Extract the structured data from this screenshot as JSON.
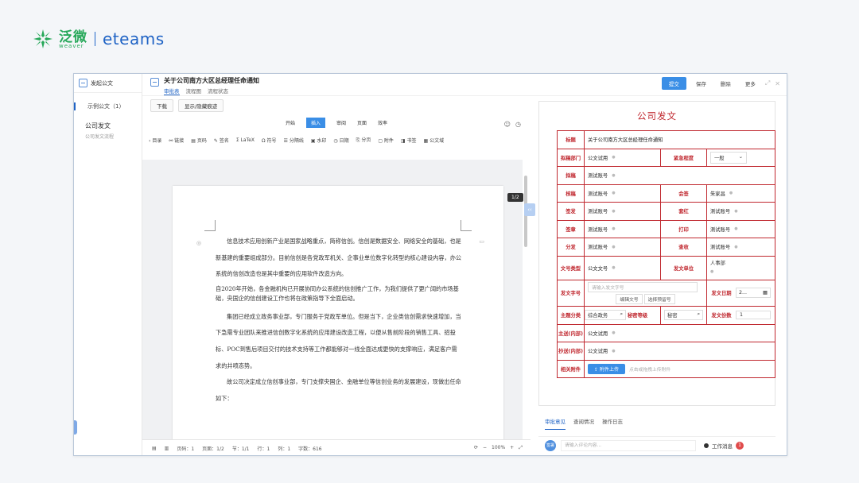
{
  "brand": {
    "cn": "泛微",
    "en": "weaver",
    "product": "eteams"
  },
  "sidebar": {
    "header": "发起公文",
    "tree_top": "示例公文（1）",
    "item": "公司发文",
    "item_sub": "公司发文流程"
  },
  "topbar": {
    "title": "关于公司南方大区总经理任命通知",
    "tabs": [
      "审批表",
      "流程图",
      "流程状态"
    ],
    "actions": {
      "submit": "提交",
      "save": "保存",
      "delete": "删除",
      "more": "更多"
    }
  },
  "editor": {
    "download": "下载",
    "toggle_marks": "显示/隐藏痕迹",
    "menu_tabs": [
      "开始",
      "插入",
      "审阅",
      "页面",
      "效率"
    ],
    "toolbar": [
      "目录",
      "链接",
      "页码",
      "签名",
      "LaTeX",
      "符号",
      "分隔线",
      "水印",
      "日期",
      "分页",
      "附件",
      "书签",
      "公文域"
    ],
    "page_badge": "1/2",
    "paragraphs": [
      "信息技术应用创新产业是国家战略重点，简称信创。信创是数据安全、网络安全的基础，也是新基建的重要组成部分。目前信创是各党政军机关、企事业单位数字化转型的核心建设内容，办公系统的信创改造也是其中重要的应用软件改造方向。",
      "自2020年开始，各金融机构已开展协同办公系统的信创推广工作，为我们提供了更广阔的市场基础，央国企的信创建设工作也将在政策指导下全面启动。",
      "集团已经成立政务事业部，专门服务于党政军单位。但是当下，企业类信创需求快速增加，当下急需专业团队来推进信创数字化系统的应用建设改造工程，以便从售前阶段的销售工具、招投标、POC到售后项目交付的技术支持等工作都能够对一线全面达成更快的支撑响应，满足客户需求的井喷态势。",
      "故公司决定成立信创事业部，专门支撑央国企、金融单位等信创业务的发展建设，现做出任命如下："
    ],
    "status": {
      "page": "页码：1",
      "pages": "页面：1/2",
      "section": "节：1/1",
      "row": "行：1",
      "col": "列：1",
      "chars": "字数：616",
      "zoom": "100%"
    }
  },
  "form": {
    "title": "公司发文",
    "fields": {
      "subject_label": "标题",
      "subject": "关于公司南方大区总经理任命通知",
      "dept_label": "拟稿部门",
      "dept": "公文试用",
      "urgency_label": "紧急程度",
      "urgency": "一般",
      "drafter_label": "拟稿",
      "drafter": "测试账号",
      "checker_label": "核稿",
      "checker": "测试账号",
      "countersign_label": "会签",
      "countersign": "朱家昌",
      "issuer_label": "签发",
      "issuer": "测试账号",
      "redhead_label": "套红",
      "redhead": "测试账号",
      "seal_label": "签章",
      "seal": "测试账号",
      "print_label": "打印",
      "print": "测试账号",
      "distribute_label": "分发",
      "distribute": "测试账号",
      "proof_label": "查收",
      "proof": "测试账号",
      "doctype_label": "文号类型",
      "doctype": "公文文号",
      "unit_label": "发文单位",
      "unit": "人事部",
      "docno_label": "发文字号",
      "docno_placeholder": "请输入发文字号",
      "edit_no": "编辑文号",
      "pick_no": "选择预留号",
      "date_label": "发文日期",
      "date": "2...",
      "subject_cat_label": "主题分类",
      "subject_cat": "综合政务",
      "secret_label": "秘密等级",
      "secret": "秘密",
      "copies_label": "发文份数",
      "copies": "1",
      "to_label": "主送(内部)",
      "to": "公文试用",
      "cc_label": "抄送(内部)",
      "cc": "公文试用",
      "attach_label": "相关附件",
      "upload": "附件上传",
      "upload_hint": "点击或拖拽上传附件"
    }
  },
  "bottom": {
    "tabs": [
      "审批意见",
      "查阅情况",
      "操作日志"
    ],
    "avatar": "签署",
    "comment_placeholder": "请输入评论内容...",
    "work_msg": "工作消息",
    "msg_count": "1"
  },
  "colors": {
    "accent": "#3a8ee6",
    "form_red": "#c0282f",
    "brand_green": "#27a85a"
  }
}
